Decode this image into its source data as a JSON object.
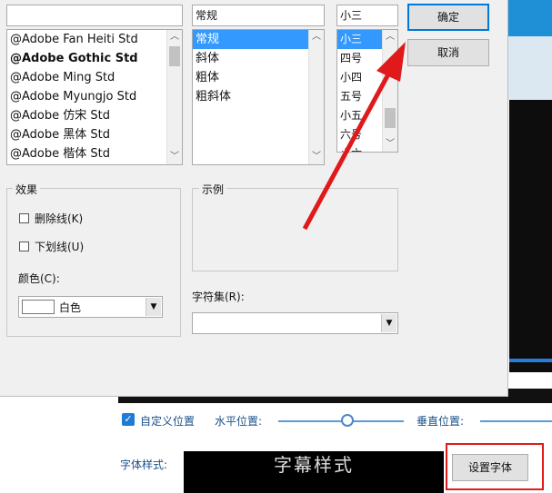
{
  "font_list": {
    "items": [
      "@Adobe Fan Heiti Std",
      "@Adobe Gothic Std",
      "@Adobe Ming Std",
      "@Adobe Myungjo Std",
      "@Adobe 仿宋 Std",
      "@Adobe 黑体 Std",
      "@Adobe 楷体 Std"
    ],
    "search_value": ""
  },
  "style_list": {
    "value": "常规",
    "items": [
      "常规",
      "斜体",
      "粗体",
      "粗斜体"
    ],
    "selected_index": 0
  },
  "size_list": {
    "value": "小三",
    "items": [
      "小三",
      "四号",
      "小四",
      "五号",
      "小五",
      "六号",
      "小六"
    ],
    "selected_index": 0
  },
  "buttons": {
    "ok": "确定",
    "cancel": "取消"
  },
  "effects": {
    "title": "效果",
    "strikeout": "删除线(K)",
    "underline": "下划线(U)",
    "color_label": "颜色(C):",
    "color_value": "白色",
    "color_swatch": "#ffffff"
  },
  "sample": {
    "title": "示例"
  },
  "charset": {
    "label": "字符集(R):",
    "value": ""
  },
  "bottom": {
    "custom_position_label": "自定义位置",
    "custom_position_checked": true,
    "horizontal_label": "水平位置:",
    "horizontal_value": 0.55,
    "vertical_label": "垂直位置:",
    "font_style_label": "字体样式:",
    "subtitle_preview_text": "字幕样式",
    "set_font_button": "设置字体"
  },
  "colors": {
    "accent_red": "#e0191b",
    "selection_blue": "#3399ff",
    "checkbox_blue": "#1e7bd6"
  }
}
